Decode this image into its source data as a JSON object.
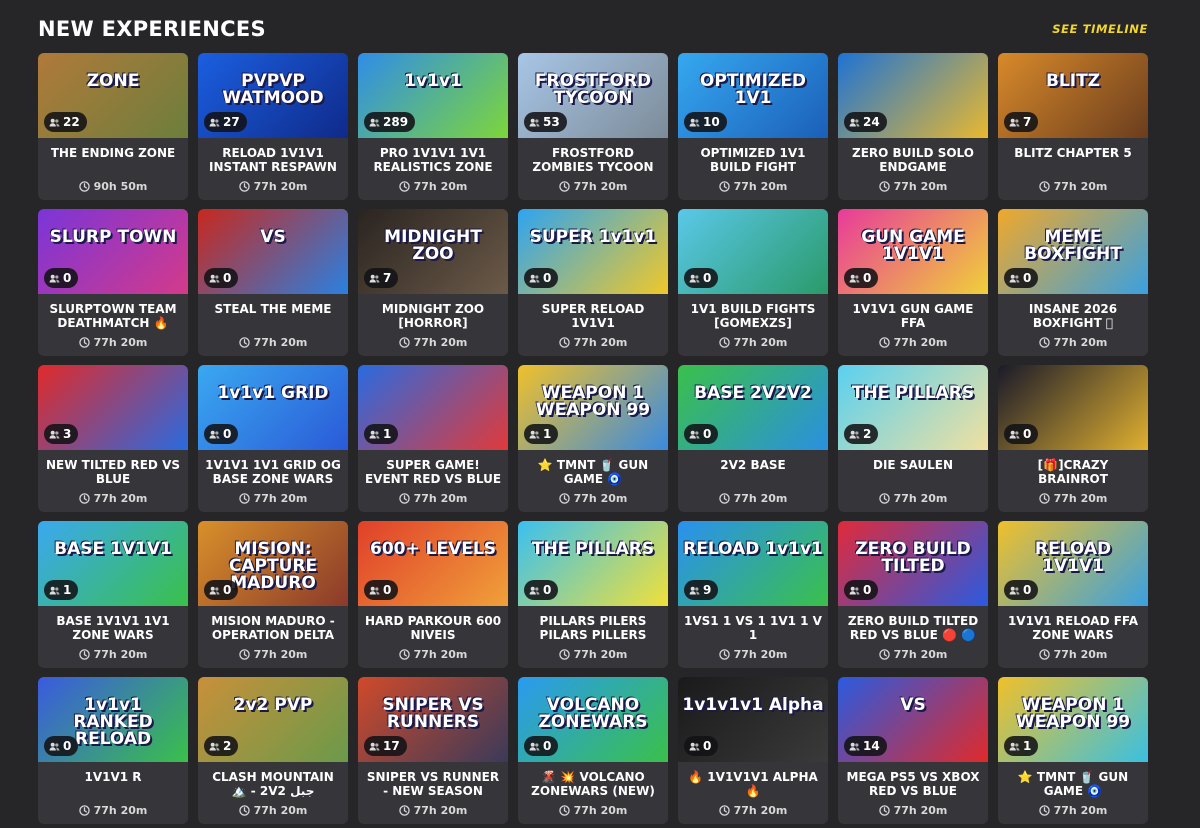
{
  "header": {
    "title": "NEW EXPERIENCES",
    "see_timeline": "SEE TIMELINE"
  },
  "cards": [
    {
      "title": "THE ENDING ZONE",
      "players": "22",
      "time": "90h 50m",
      "thumb_text": "ZONE",
      "bg": [
        "#b07a3a",
        "#6d7e3c"
      ]
    },
    {
      "title": "RELOAD 1V1V1 INSTANT RESPAWN",
      "players": "27",
      "time": "77h 20m",
      "thumb_text": "PVPVP WATMOOD",
      "bg": [
        "#1b5fe0",
        "#0f2a8a"
      ]
    },
    {
      "title": "PRO 1V1V1 1V1 REALISTICS ZONE",
      "players": "289",
      "time": "77h 20m",
      "thumb_text": "1v1v1",
      "bg": [
        "#2f8de8",
        "#7dd63a"
      ]
    },
    {
      "title": "FROSTFORD ZOMBIES TYCOON",
      "players": "53",
      "time": "77h 20m",
      "thumb_text": "FROSTFORD TYCOON",
      "bg": [
        "#a7c6e6",
        "#7d8b99"
      ]
    },
    {
      "title": "OPTIMIZED 1V1 BUILD FIGHT",
      "players": "10",
      "time": "77h 20m",
      "thumb_text": "OPTIMIZED 1V1",
      "bg": [
        "#36a8f0",
        "#1b5fb8"
      ]
    },
    {
      "title": "ZERO BUILD SOLO ENDGAME",
      "players": "24",
      "time": "77h 20m",
      "thumb_text": "",
      "bg": [
        "#1e73d4",
        "#e8b830"
      ]
    },
    {
      "title": "BLITZ CHAPTER 5",
      "players": "7",
      "time": "77h 20m",
      "thumb_text": "BLITZ",
      "bg": [
        "#d88a2a",
        "#6b3d1e"
      ]
    },
    {
      "title": "SLURPTOWN TEAM DEATHMATCH 🔥",
      "players": "0",
      "time": "77h 20m",
      "thumb_text": "SLURP TOWN",
      "bg": [
        "#7a35d8",
        "#d43a8a"
      ]
    },
    {
      "title": "STEAL THE MEME",
      "players": "0",
      "time": "77h 20m",
      "thumb_text": "VS",
      "bg": [
        "#c8281e",
        "#2a80e0"
      ]
    },
    {
      "title": "MIDNIGHT ZOO [HORROR]",
      "players": "7",
      "time": "77h 20m",
      "thumb_text": "MIDNIGHT ZOO",
      "bg": [
        "#2a2420",
        "#6b5a48"
      ]
    },
    {
      "title": "SUPER RELOAD 1V1V1",
      "players": "0",
      "time": "77h 20m",
      "thumb_text": "SUPER 1v1v1",
      "bg": [
        "#2ea4f0",
        "#f0c82a"
      ]
    },
    {
      "title": "1V1 BUILD FIGHTS [GOMEXZS]",
      "players": "0",
      "time": "77h 20m",
      "thumb_text": "",
      "bg": [
        "#5ac8e8",
        "#2a9a6a"
      ]
    },
    {
      "title": "1V1V1 GUN GAME FFA",
      "players": "0",
      "time": "77h 20m",
      "thumb_text": "GUN GAME 1V1V1",
      "bg": [
        "#e83a9a",
        "#f0d03a"
      ]
    },
    {
      "title": "INSANE 2026 BOXFIGHT 🏽",
      "players": "0",
      "time": "77h 20m",
      "thumb_text": "MEME BOXFIGHT",
      "bg": [
        "#f0a82a",
        "#3aa0e0"
      ]
    },
    {
      "title": "NEW TILTED RED VS BLUE",
      "players": "3",
      "time": "77h 20m",
      "thumb_text": "",
      "bg": [
        "#e02a2a",
        "#2a6ae0"
      ]
    },
    {
      "title": "1V1V1 1V1 GRID OG BASE ZONE WARS",
      "players": "0",
      "time": "77h 20m",
      "thumb_text": "1v1v1 GRID",
      "bg": [
        "#3aa8f0",
        "#2a5ad8"
      ]
    },
    {
      "title": "SUPER GAME! EVENT RED VS BLUE",
      "players": "1",
      "time": "77h 20m",
      "thumb_text": "",
      "bg": [
        "#2a6ae0",
        "#e03a3a"
      ]
    },
    {
      "title": "⭐ TMNT 🥤 GUN GAME 🧿",
      "players": "1",
      "time": "77h 20m",
      "thumb_text": "WEAPON 1  WEAPON 99",
      "bg": [
        "#f0c02a",
        "#3a8ae0"
      ]
    },
    {
      "title": "2V2 BASE",
      "players": "0",
      "time": "77h 20m",
      "thumb_text": "BASE 2V2V2",
      "bg": [
        "#3ac04a",
        "#2a90e0"
      ]
    },
    {
      "title": "DIE SAULEN",
      "players": "2",
      "time": "77h 20m",
      "thumb_text": "THE PILLARS",
      "bg": [
        "#5ad0f0",
        "#f0e0a0"
      ]
    },
    {
      "title": "[🎁]CRAZY BRAINROT",
      "players": "0",
      "time": "77h 20m",
      "thumb_text": "",
      "bg": [
        "#1a1a2a",
        "#e0b030"
      ]
    },
    {
      "title": "BASE 1V1V1 1V1 ZONE WARS",
      "players": "1",
      "time": "77h 20m",
      "thumb_text": "BASE 1V1V1",
      "bg": [
        "#3aa8f0",
        "#3ac04a"
      ]
    },
    {
      "title": "MISION MADURO - OPERATION DELTA",
      "players": "0",
      "time": "77h 20m",
      "thumb_text": "MISION: CAPTURE MADURO",
      "bg": [
        "#d8902a",
        "#8a3a2a"
      ]
    },
    {
      "title": "HARD PARKOUR 600 NIVEIS",
      "players": "0",
      "time": "77h 20m",
      "thumb_text": "600+ LEVELS",
      "bg": [
        "#e0402a",
        "#f0a03a"
      ]
    },
    {
      "title": "PILLARS PILERS PILARS PILLERS",
      "players": "0",
      "time": "77h 20m",
      "thumb_text": "THE PILLARS",
      "bg": [
        "#3ac0f0",
        "#f0e03a"
      ]
    },
    {
      "title": "1VS1 1 VS 1 1V1 1 V 1",
      "players": "9",
      "time": "77h 20m",
      "thumb_text": "RELOAD 1v1v1",
      "bg": [
        "#2a90f0",
        "#3ac04a"
      ]
    },
    {
      "title": "ZERO BUILD TILTED RED VS BLUE 🔴 🔵",
      "players": "0",
      "time": "77h 20m",
      "thumb_text": "ZERO BUILD TILTED",
      "bg": [
        "#e02a3a",
        "#2a5ae0"
      ]
    },
    {
      "title": "1V1V1 RELOAD FFA ZONE WARS",
      "players": "0",
      "time": "77h 20m",
      "thumb_text": "RELOAD 1V1V1",
      "bg": [
        "#f0c02a",
        "#3aa0e0"
      ]
    },
    {
      "title": "1V1V1 R",
      "players": "0",
      "time": "77h 20m",
      "thumb_text": "1v1v1 RANKED RELOAD",
      "bg": [
        "#3a5ae0",
        "#3ac04a"
      ]
    },
    {
      "title": "CLASH MOUNTAIN 🏔️ - 2V2 جبل المواجهة",
      "players": "2",
      "time": "77h 20m",
      "thumb_text": "2v2 PVP",
      "bg": [
        "#c8903a",
        "#6a9a4a"
      ]
    },
    {
      "title": "SNIPER VS RUNNER - NEW SEASON",
      "players": "17",
      "time": "77h 20m",
      "thumb_text": "SNIPER VS RUNNERS",
      "bg": [
        "#d04a2a",
        "#3a3a5a"
      ]
    },
    {
      "title": "🌋 💥 VOLCANO ZONEWARS (NEW)",
      "players": "0",
      "time": "77h 20m",
      "thumb_text": "VOLCANO ZONEWARS",
      "bg": [
        "#2a9af0",
        "#3ac04a"
      ]
    },
    {
      "title": "🔥 1V1V1V1 ALPHA 🔥",
      "players": "0",
      "time": "77h 20m",
      "thumb_text": "1v1v1v1 Alpha",
      "bg": [
        "#1a1a1a",
        "#3a3a3a"
      ]
    },
    {
      "title": "MEGA PS5 VS XBOX RED VS BLUE",
      "players": "14",
      "time": "77h 20m",
      "thumb_text": "VS",
      "bg": [
        "#2a5ae0",
        "#e02a2a"
      ]
    },
    {
      "title": "⭐ TMNT 🥤 GUN GAME 🧿",
      "players": "1",
      "time": "77h 20m",
      "thumb_text": "WEAPON 1  WEAPON 99",
      "bg": [
        "#f0c02a",
        "#3ac0e0"
      ]
    }
  ],
  "icons": {
    "players": "people-icon",
    "time": "clock-icon"
  }
}
